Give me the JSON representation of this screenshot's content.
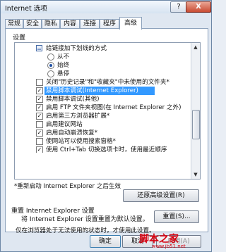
{
  "window": {
    "title": "Internet 选项",
    "help_glyph": "?",
    "close_glyph": "X"
  },
  "tabs": [
    "常规",
    "安全",
    "隐私",
    "内容",
    "连接",
    "程序",
    "高级"
  ],
  "active_tab": "高级",
  "settings": {
    "heading": "设置",
    "items": [
      {
        "type": "checkbox",
        "checked": false,
        "label": "给链接加下划线的方式"
      },
      {
        "type": "radio",
        "checked": false,
        "label": "从不"
      },
      {
        "type": "radio",
        "checked": true,
        "label": "始终"
      },
      {
        "type": "radio",
        "checked": false,
        "label": "悬停"
      },
      {
        "type": "checkbox",
        "checked": false,
        "label": "关闭\"历史记录\"和\"收藏夹\"中未使用的文件夹*"
      },
      {
        "type": "checkbox",
        "checked": true,
        "label": "禁用脚本调试(Internet Explorer)",
        "selected": true
      },
      {
        "type": "checkbox",
        "checked": true,
        "label": "禁用脚本调试(其他)"
      },
      {
        "type": "checkbox",
        "checked": true,
        "label": "启用 FTP 文件夹视图(在 Internet Explorer 之外)"
      },
      {
        "type": "checkbox",
        "checked": true,
        "label": "启用第三方浏览器扩展*"
      },
      {
        "type": "checkbox",
        "checked": false,
        "label": "启用建议网站"
      },
      {
        "type": "checkbox",
        "checked": true,
        "label": "启用自动崩溃恢复*"
      },
      {
        "type": "checkbox",
        "checked": false,
        "label": "使网站可以使用搜索窗格*"
      },
      {
        "type": "checkbox",
        "checked": true,
        "label": "使用 Ctrl+Tab 切换选项卡时，使用最近顺序"
      }
    ],
    "check_mark": "✓",
    "scroll_up": "▲",
    "scroll_down": "▼"
  },
  "restart_note": "*重新启动 Internet Explorer 之后生效",
  "restore_button": "还原高级设置(R)",
  "reset_section": {
    "heading": "重置 Internet Explorer 设置",
    "description": "将 Internet Explorer 设置重置为默认设置。",
    "reset_button": "重置(S)...",
    "note": "仅在浏览器处于无法使用的状态时，才使用此设置。"
  },
  "footer": {
    "ok": "确定",
    "cancel": "取消",
    "apply": "应用(A)"
  },
  "watermark": {
    "line1": "脚本之家",
    "line2": "www.jb51.net"
  }
}
